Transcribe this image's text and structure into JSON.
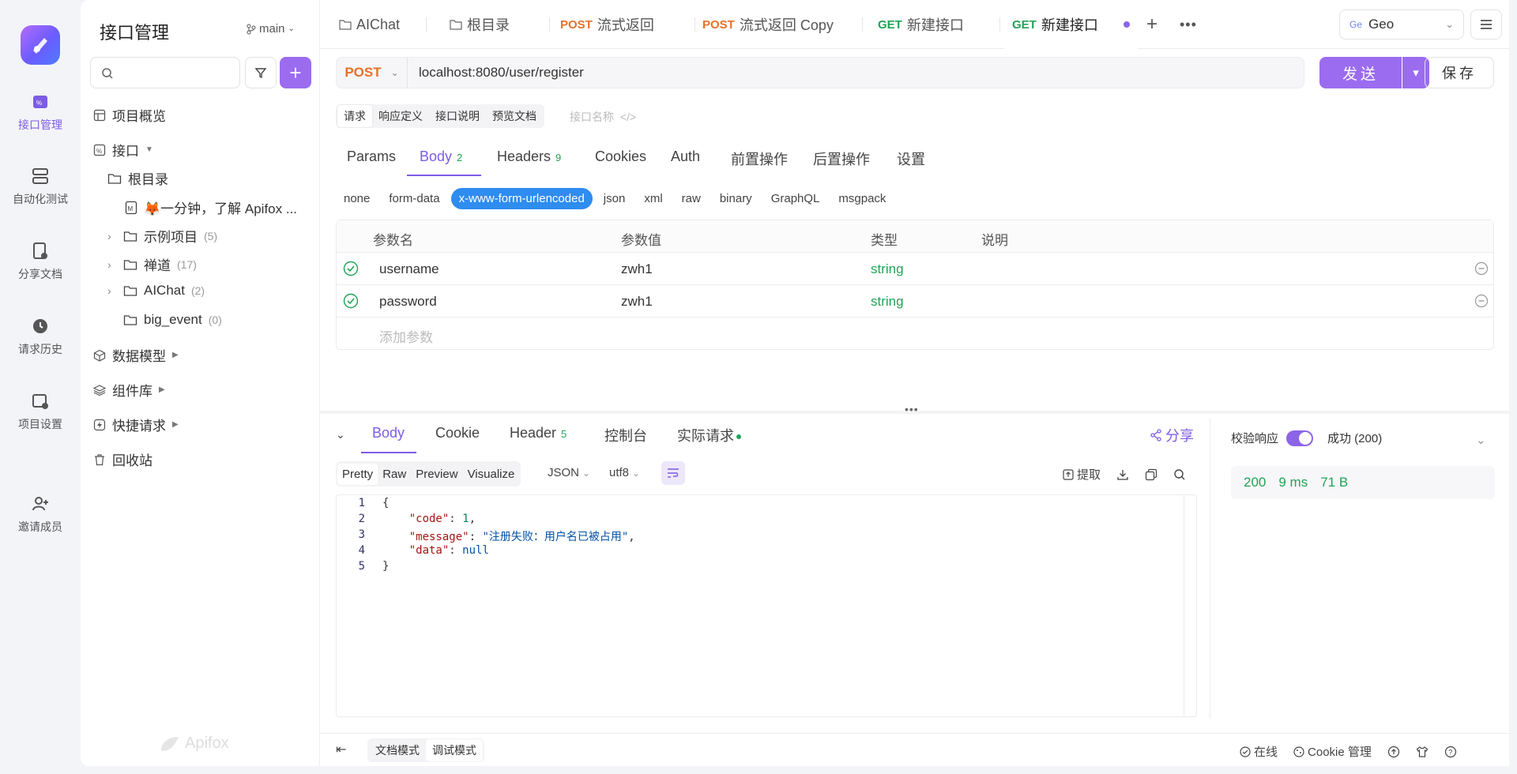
{
  "rail": {
    "items": [
      {
        "label": "接口管理"
      },
      {
        "label": "自动化测试"
      },
      {
        "label": "分享文档"
      },
      {
        "label": "请求历史"
      },
      {
        "label": "项目设置"
      },
      {
        "label": "邀请成员"
      }
    ]
  },
  "sidebar": {
    "title": "接口管理",
    "branch": "main",
    "tree": [
      {
        "label": "项目概览"
      },
      {
        "label": "接口"
      },
      {
        "label": "根目录"
      },
      {
        "label": "🦊一分钟，了解 Apifox ..."
      },
      {
        "label": "示例项目",
        "count": "(5)"
      },
      {
        "label": "禅道",
        "count": "(17)"
      },
      {
        "label": "AIChat",
        "count": "(2)"
      },
      {
        "label": "big_event",
        "count": "(0)"
      },
      {
        "label": "数据模型"
      },
      {
        "label": "组件库"
      },
      {
        "label": "快捷请求"
      },
      {
        "label": "回收站"
      }
    ],
    "watermark": "Apifox"
  },
  "tabs": [
    {
      "method": "",
      "label": "AIChat"
    },
    {
      "method": "",
      "label": "根目录"
    },
    {
      "method": "POST",
      "label": "流式返回"
    },
    {
      "method": "POST",
      "label": "流式返回 Copy"
    },
    {
      "method": "GET",
      "label": "新建接口"
    },
    {
      "method": "GET",
      "label": "新建接口"
    }
  ],
  "env": {
    "badge": "Ge",
    "name": "Geo"
  },
  "request": {
    "method": "POST",
    "url": "localhost:8080/user/register",
    "send_label": "发送",
    "save_label": "保存"
  },
  "modes": [
    "请求",
    "响应定义",
    "接口说明",
    "预览文档"
  ],
  "iface_name_placeholder": "接口名称",
  "req_tabs": [
    {
      "label": "Params",
      "count": ""
    },
    {
      "label": "Body",
      "count": "2"
    },
    {
      "label": "Headers",
      "count": "9"
    },
    {
      "label": "Cookies",
      "count": ""
    },
    {
      "label": "Auth",
      "count": ""
    },
    {
      "label": "前置操作",
      "count": ""
    },
    {
      "label": "后置操作",
      "count": ""
    },
    {
      "label": "设置",
      "count": ""
    }
  ],
  "body_types": [
    "none",
    "form-data",
    "x-www-form-urlencoded",
    "json",
    "xml",
    "raw",
    "binary",
    "GraphQL",
    "msgpack"
  ],
  "params": {
    "headers": [
      "参数名",
      "参数值",
      "类型",
      "说明"
    ],
    "rows": [
      {
        "name": "username",
        "value": "zwh1",
        "type": "string",
        "desc": ""
      },
      {
        "name": "password",
        "value": "zwh1",
        "type": "string",
        "desc": ""
      }
    ],
    "add_placeholder": "添加参数"
  },
  "response": {
    "tabs": [
      {
        "label": "Body",
        "count": ""
      },
      {
        "label": "Cookie",
        "count": ""
      },
      {
        "label": "Header",
        "count": "5"
      },
      {
        "label": "控制台",
        "count": ""
      },
      {
        "label": "实际请求",
        "count": ""
      }
    ],
    "share_label": "分享",
    "view_tabs": [
      "Pretty",
      "Raw",
      "Preview",
      "Visualize"
    ],
    "format": "JSON",
    "encoding": "utf8",
    "extract_label": "提取",
    "code_lines": [
      {
        "no": "1"
      },
      {
        "no": "2",
        "key": "\"code\"",
        "val": "1"
      },
      {
        "no": "3",
        "key": "\"message\"",
        "val": "\"注册失败：用户名已被占用\""
      },
      {
        "no": "4",
        "key": "\"data\"",
        "val": "null"
      },
      {
        "no": "5"
      }
    ],
    "validate_label": "校验响应",
    "status_label": "成功 (200)",
    "status_code": "200",
    "time": "9 ms",
    "size": "71 B"
  },
  "footer": {
    "doc_mode": "文档模式",
    "debug_mode": "调试模式",
    "online": "在线",
    "cookie_mgr": "Cookie 管理"
  },
  "colors": {
    "accent": "#9b6cf0",
    "post": "#e8702a",
    "get": "#21a356",
    "body_type_active": "#2f8cf0"
  }
}
